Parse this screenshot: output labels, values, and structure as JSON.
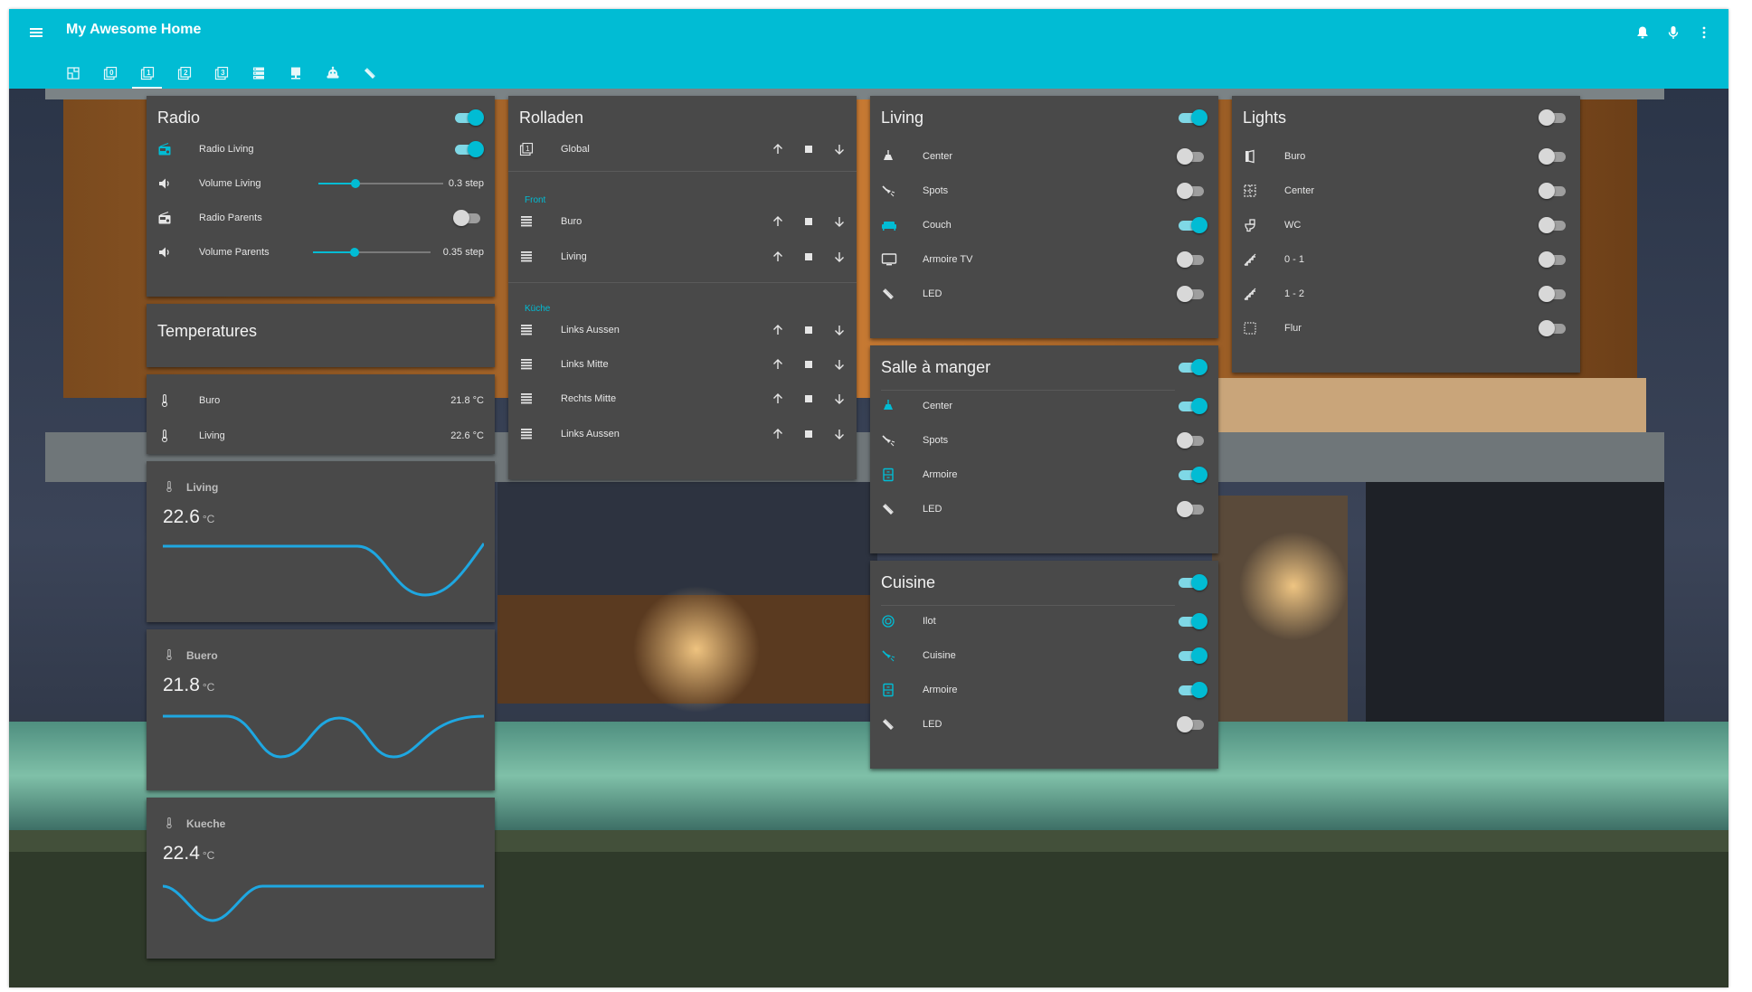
{
  "app": {
    "title": "My Awesome Home"
  },
  "colors": {
    "accent": "#01BCD4",
    "header": "#01BCD4",
    "card": "#494949",
    "toggle_off": "#d8d8d8"
  },
  "header": {
    "tabs": [
      {
        "icon": "floorplan-icon",
        "active": false
      },
      {
        "icon": "numeric-0-box-icon",
        "active": false
      },
      {
        "icon": "numeric-1-box-icon",
        "active": true
      },
      {
        "icon": "numeric-2-box-icon",
        "active": false
      },
      {
        "icon": "numeric-3-box-icon",
        "active": false
      },
      {
        "icon": "server-icon",
        "active": false
      },
      {
        "icon": "desk-lamp-icon",
        "active": false
      },
      {
        "icon": "robot-icon",
        "active": false
      },
      {
        "icon": "led-strip-icon",
        "active": false
      }
    ],
    "actions": [
      "bell-icon",
      "microphone-icon",
      "more-vertical-icon"
    ]
  },
  "radio": {
    "title": "Radio",
    "master_on": true,
    "items": [
      {
        "label": "Radio Living",
        "type": "toggle",
        "on": true,
        "icon": "radio-icon",
        "active_icon": true
      },
      {
        "label": "Volume Living",
        "type": "slider",
        "value": "0.3 step",
        "level": 0.3,
        "icon": "volume-icon"
      },
      {
        "label": "Radio Parents",
        "type": "toggle",
        "on": false,
        "icon": "radio-icon"
      },
      {
        "label": "Volume Parents",
        "type": "slider",
        "value": "0.35 step",
        "level": 0.35,
        "icon": "volume-icon"
      }
    ]
  },
  "temperatures": {
    "title": "Temperatures",
    "items": [
      {
        "label": "Buro",
        "value": "21.8 °C"
      },
      {
        "label": "Living",
        "value": "22.6 °C"
      }
    ]
  },
  "sensors": [
    {
      "name": "Living",
      "value": "22.6",
      "unit": "°C"
    },
    {
      "name": "Buero",
      "value": "21.8",
      "unit": "°C"
    },
    {
      "name": "Kueche",
      "value": "22.4",
      "unit": "°C"
    }
  ],
  "rolladen": {
    "title": "Rolladen",
    "global_label": "Global",
    "front_label": "Front",
    "front": [
      "Buro",
      "Living"
    ],
    "kueche_label": "Küche",
    "kueche": [
      "Links Aussen",
      "Links Mitte",
      "Rechts Mitte",
      "Links Aussen"
    ]
  },
  "living": {
    "title": "Living",
    "master_on": true,
    "items": [
      {
        "label": "Center",
        "on": false,
        "icon": "ceiling-light-icon"
      },
      {
        "label": "Spots",
        "on": false,
        "icon": "spotlight-icon"
      },
      {
        "label": "Couch",
        "on": true,
        "icon": "sofa-icon"
      },
      {
        "label": "Armoire TV",
        "on": false,
        "icon": "television-icon"
      },
      {
        "label": "LED",
        "on": false,
        "icon": "led-strip-icon"
      }
    ]
  },
  "salle": {
    "title": "Salle à manger",
    "master_on": true,
    "items": [
      {
        "label": "Center",
        "on": true,
        "icon": "ceiling-light-icon"
      },
      {
        "label": "Spots",
        "on": false,
        "icon": "spotlight-icon"
      },
      {
        "label": "Armoire",
        "on": true,
        "icon": "cabinet-icon"
      },
      {
        "label": "LED",
        "on": false,
        "icon": "led-strip-icon"
      }
    ]
  },
  "cuisine": {
    "title": "Cuisine",
    "master_on": true,
    "items": [
      {
        "label": "Ilot",
        "on": true,
        "icon": "hob-icon"
      },
      {
        "label": "Cuisine",
        "on": true,
        "icon": "spotlight-icon"
      },
      {
        "label": "Armoire",
        "on": true,
        "icon": "cabinet-icon"
      },
      {
        "label": "LED",
        "on": false,
        "icon": "led-strip-icon"
      }
    ]
  },
  "lights": {
    "title": "Lights",
    "master_on": false,
    "items": [
      {
        "label": "Buro",
        "on": false,
        "icon": "door-icon"
      },
      {
        "label": "Center",
        "on": false,
        "icon": "grid-light-icon"
      },
      {
        "label": "WC",
        "on": false,
        "icon": "toilet-icon"
      },
      {
        "label": "0 - 1",
        "on": false,
        "icon": "stairs-icon"
      },
      {
        "label": "1 - 2",
        "on": false,
        "icon": "stairs-icon"
      },
      {
        "label": "Flur",
        "on": false,
        "icon": "dotted-square-icon"
      }
    ]
  }
}
